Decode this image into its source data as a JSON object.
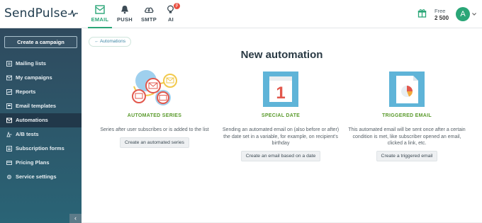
{
  "brand": {
    "name": "SendPulse"
  },
  "topnav": [
    {
      "label": "EMAIL",
      "icon": "email-icon",
      "active": true
    },
    {
      "label": "PUSH",
      "icon": "bell-icon",
      "active": false
    },
    {
      "label": "SMTP",
      "icon": "cloud-icon",
      "active": false
    },
    {
      "label": "AI",
      "icon": "ai-bulb-icon",
      "active": false,
      "badge": "β"
    }
  ],
  "account": {
    "plan_label": "Free",
    "plan_count": "2 500",
    "avatar_letter": "A",
    "accent": "#2aa677"
  },
  "sidebar": {
    "create_button": "Create a campaign",
    "items": [
      {
        "label": "Mailing lists",
        "icon": "mailing-lists-icon"
      },
      {
        "label": "My campaigns",
        "icon": "campaigns-icon"
      },
      {
        "label": "Reports",
        "icon": "reports-icon"
      },
      {
        "label": "Email templates",
        "icon": "templates-icon"
      },
      {
        "label": "Automations",
        "icon": "automations-icon",
        "active": true
      },
      {
        "label": "A/B tests",
        "icon": "ab-tests-icon"
      },
      {
        "label": "Subscription forms",
        "icon": "forms-icon"
      },
      {
        "label": "Pricing Plans",
        "icon": "pricing-icon"
      },
      {
        "label": "Service settings",
        "icon": "settings-icon"
      }
    ],
    "collapse_glyph": "‹"
  },
  "main": {
    "back_link": "← Automations",
    "title": "New automation",
    "cards": [
      {
        "title": "AUTOMATED SERIES",
        "description": "Series after user subscribes or is added to the list",
        "button": "Create an automated series"
      },
      {
        "title": "SPECIAL DATE",
        "description": "Sending an automated email on (also before or after) the date set in a variable, for example, on recipient's birthday",
        "button": "Create an email based on a date",
        "calendar_number": "1"
      },
      {
        "title": "TRIGGERED EMAIL",
        "description": "This automated email will be sent once after a certain condition is met, like subscriber opened an email, clicked a link, etc.",
        "button": "Create a triggered email"
      }
    ]
  }
}
